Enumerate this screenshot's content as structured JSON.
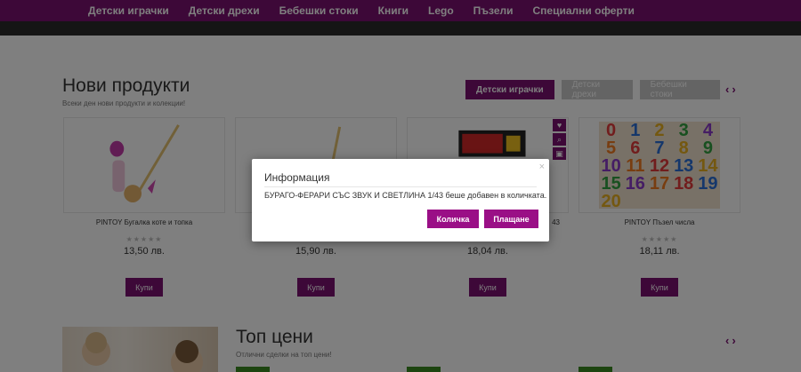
{
  "nav": {
    "items": [
      "Детски играчки",
      "Детски дрехи",
      "Бебешки стоки",
      "Книги",
      "Lego",
      "Пъзели",
      "Специални оферти"
    ]
  },
  "new_products": {
    "title": "Нови продукти",
    "subtitle": "Всеки ден нови продукти и колекции!",
    "filters": [
      "Детски играчки",
      "Детски дрехи",
      "Бебешки стоки"
    ],
    "arrows": {
      "prev": "‹",
      "next": "›"
    },
    "products": [
      {
        "name": "PINTOY Бугалка коте и топка",
        "price": "13,50 лв.",
        "buy": "Купи"
      },
      {
        "name": "",
        "price": "15,90 лв.",
        "buy": "Купи"
      },
      {
        "name": "43",
        "price": "18,04 лв.",
        "buy": "Купи"
      },
      {
        "name": "PINTOY Пъзел числа",
        "price": "18,11 лв.",
        "buy": "Купи"
      }
    ],
    "stars": "★★★★★",
    "puzzle_numbers": [
      "0",
      "1",
      "2",
      "3",
      "4",
      "5",
      "6",
      "7",
      "8",
      "9",
      "10",
      "11",
      "12",
      "13",
      "14",
      "15",
      "16",
      "17",
      "18",
      "19",
      "20"
    ]
  },
  "top_prices": {
    "title": "Топ цени",
    "subtitle": "Отлични сделки на топ цени!",
    "arrows": {
      "prev": "‹",
      "next": "›"
    }
  },
  "modal": {
    "title": "Информация",
    "close": "×",
    "message": "БУРАГО-ФЕРАРИ СЪС ЗВУК И СВЕТЛИНА 1/43 беше добавен в количката.",
    "cart_button": "Количка",
    "checkout_button": "Плащане"
  },
  "colors": {
    "brand": "#7a1070",
    "modal_button": "#9a0f86"
  },
  "icons": [
    "heart-icon",
    "search-icon",
    "image-icon"
  ]
}
